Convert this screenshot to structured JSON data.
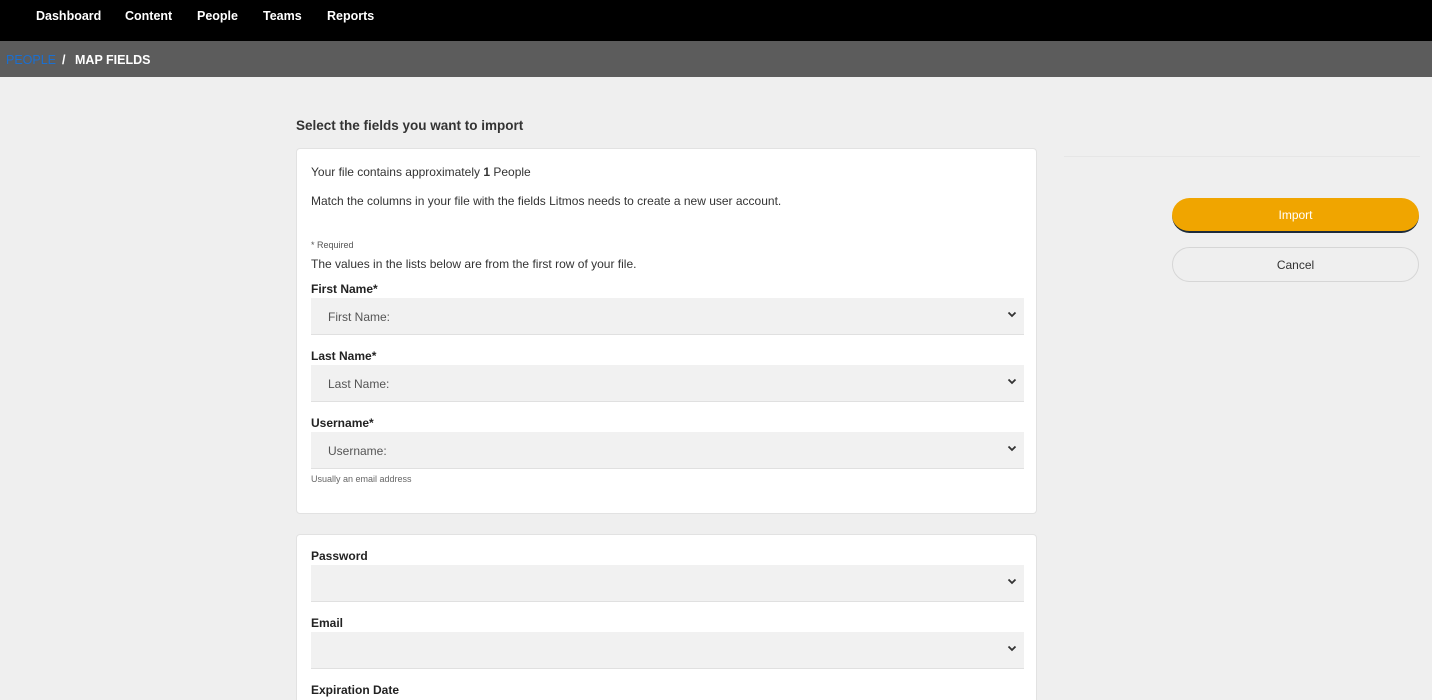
{
  "nav": {
    "items": [
      "Dashboard",
      "Content",
      "People",
      "Teams",
      "Reports"
    ]
  },
  "breadcrumb": {
    "parent": "PEOPLE",
    "separator": "/",
    "current": "MAP FIELDS"
  },
  "page": {
    "heading": "Select the fields you want to import"
  },
  "card1": {
    "info_prefix": "Your file contains approximately",
    "info_count": "1",
    "info_suffix": "People",
    "match_text": "Match the columns in your file with the fields Litmos needs to create a new user account.",
    "required_note": "* Required",
    "values_note": "The values in the lists below are from the first row of your file.",
    "fields": [
      {
        "label": "First Name*",
        "value": "First Name:"
      },
      {
        "label": "Last Name*",
        "value": "Last Name:"
      },
      {
        "label": "Username*",
        "value": "Username:"
      }
    ],
    "username_hint": "Usually an email address"
  },
  "card2": {
    "fields": [
      {
        "label": "Password",
        "value": ""
      },
      {
        "label": "Email",
        "value": ""
      },
      {
        "label": "Expiration Date",
        "value": ""
      }
    ]
  },
  "actions": {
    "import_label": "Import",
    "cancel_label": "Cancel"
  },
  "colors": {
    "nav_bg": "#000000",
    "breadcrumb_bg": "#5c5c5c",
    "link": "#1a6fd1",
    "primary": "#f0a500",
    "page_bg": "#efefef"
  },
  "icons": {
    "select_chevron": "chevron-down-icon"
  }
}
